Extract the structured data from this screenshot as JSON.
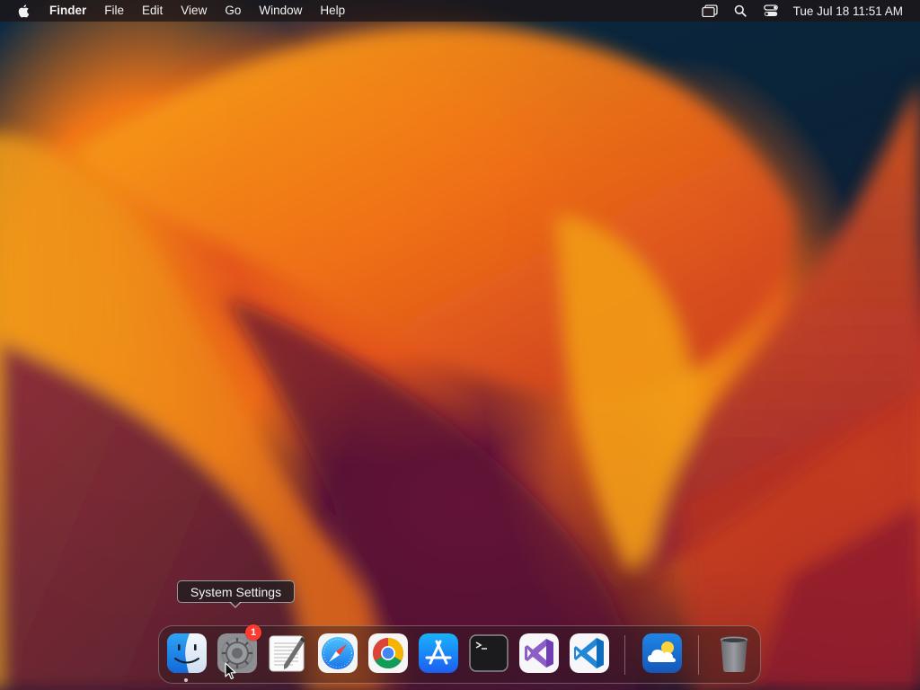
{
  "menubar": {
    "apple_icon": "apple-logo-icon",
    "app_name": "Finder",
    "items": [
      "File",
      "Edit",
      "View",
      "Go",
      "Window",
      "Help"
    ],
    "status_icons": [
      "screen-mirroring-icon",
      "spotlight-search-icon",
      "control-center-icon"
    ],
    "clock": "Tue Jul 18  11:51 AM"
  },
  "tooltip": {
    "text": "System Settings"
  },
  "dock": {
    "apps": [
      {
        "name": "Finder",
        "icon": "finder-icon",
        "running": true
      },
      {
        "name": "System Settings",
        "icon": "system-settings-icon",
        "badge": "1",
        "hovered": true
      },
      {
        "name": "TextEdit",
        "icon": "textedit-icon"
      },
      {
        "name": "Safari",
        "icon": "safari-icon"
      },
      {
        "name": "Google Chrome",
        "icon": "chrome-icon"
      },
      {
        "name": "App Store",
        "icon": "app-store-icon"
      },
      {
        "name": "Terminal",
        "icon": "terminal-icon"
      },
      {
        "name": "Visual Studio",
        "icon": "visual-studio-icon"
      },
      {
        "name": "Visual Studio Code",
        "icon": "vscode-icon"
      },
      {
        "name": "Weather",
        "icon": "weather-icon"
      },
      {
        "name": "Trash",
        "icon": "trash-icon"
      }
    ],
    "badge_color": "#ff3b30"
  },
  "colors": {
    "menubar_bg": "#1c1416",
    "wallpaper_orange": "#f39a15",
    "wallpaper_red": "#c8321e",
    "wallpaper_navy": "#0b2236"
  }
}
